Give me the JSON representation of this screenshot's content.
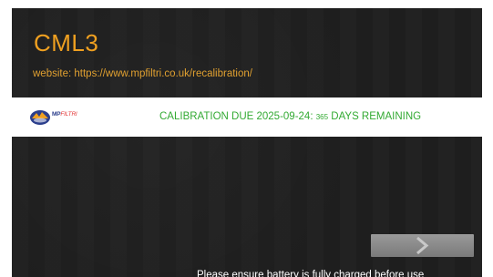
{
  "device": {
    "title": "CML3",
    "website": "website: https://www.mpfiltri.co.uk/recalibration/"
  },
  "banner": {
    "logo": {
      "icon": "mp-filtri-logo-icon",
      "brand_mp": "MP",
      "brand_filtri": "FILTRI"
    },
    "calibration_prefix": "CALIBRATION DUE 2025-09-24: ",
    "days_number": "365",
    "days_suffix": " DAYS REMAINING"
  },
  "navigation": {
    "next_icon": "chevron-right-icon"
  },
  "footer": {
    "battery_note": "Please ensure battery is fully charged before use"
  },
  "colors": {
    "background": "#1e1e1e",
    "title": "#f0a020",
    "calibration_text": "#33aa33",
    "button": "#8a8a8a"
  }
}
